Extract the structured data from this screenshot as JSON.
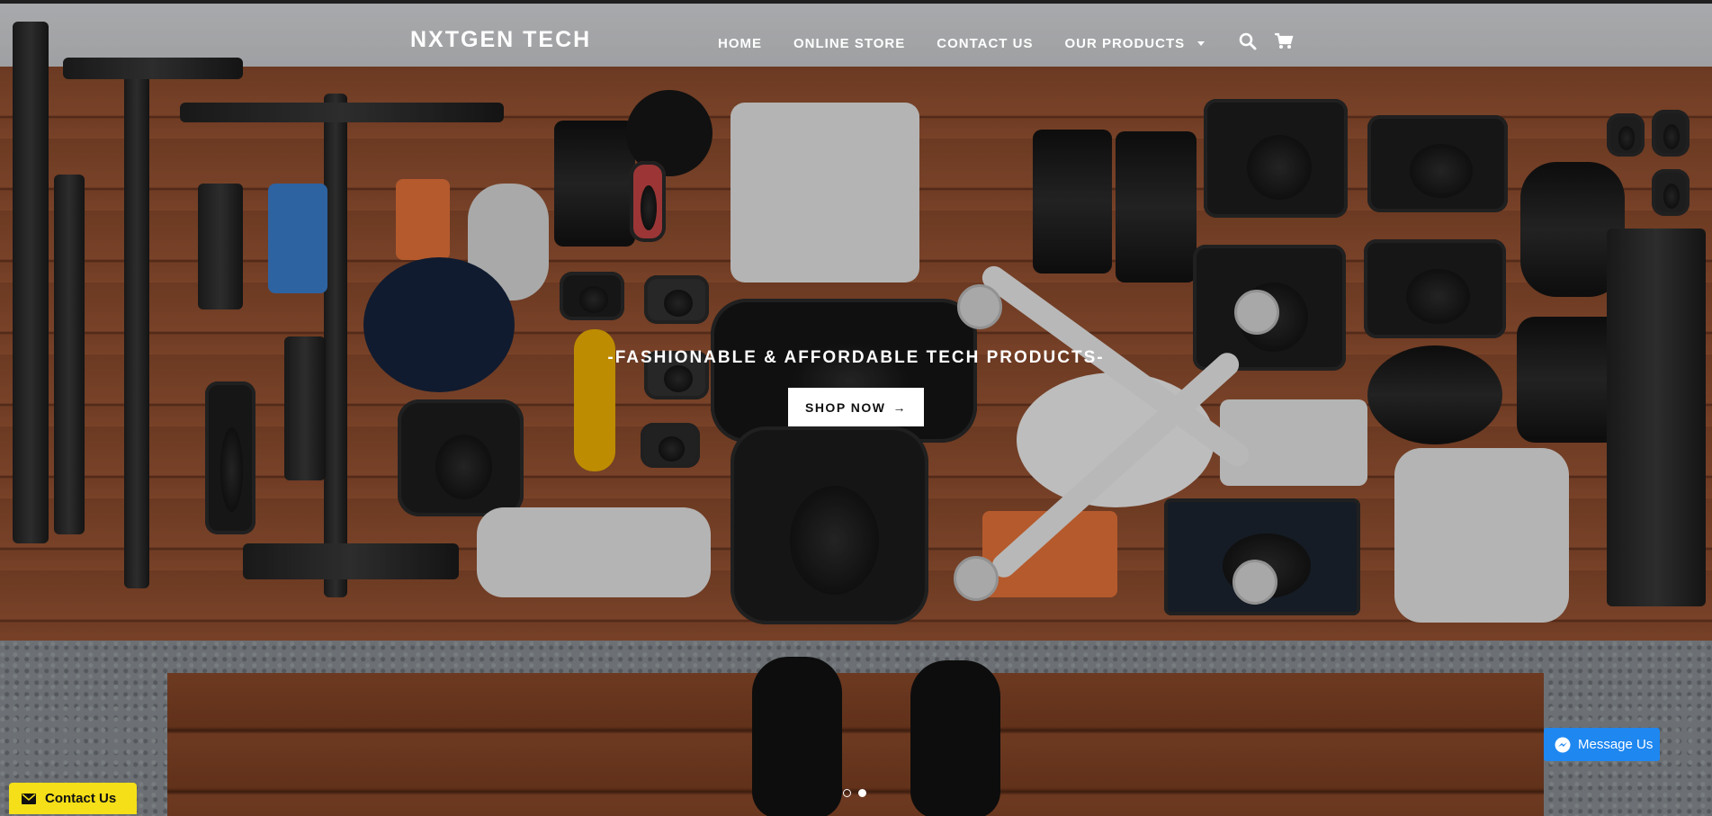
{
  "site": {
    "title": "NXTGEN TECH"
  },
  "nav": {
    "items": [
      {
        "label": "HOME"
      },
      {
        "label": "ONLINE STORE"
      },
      {
        "label": "CONTACT US"
      },
      {
        "label": "OUR PRODUCTS"
      }
    ],
    "icons": [
      "search-icon",
      "cart-icon"
    ]
  },
  "hero": {
    "tagline": "-FASHIONABLE & AFFORDABLE TECH PRODUCTS-",
    "cta_label": "SHOP NOW",
    "cta_arrow": "→",
    "slides": {
      "count": 2,
      "active_index": 1
    }
  },
  "widgets": {
    "contact_label": "Contact Us",
    "message_label": "Message Us"
  },
  "colors": {
    "contact_widget": "#f4df18",
    "message_button": "#1e87f0"
  }
}
